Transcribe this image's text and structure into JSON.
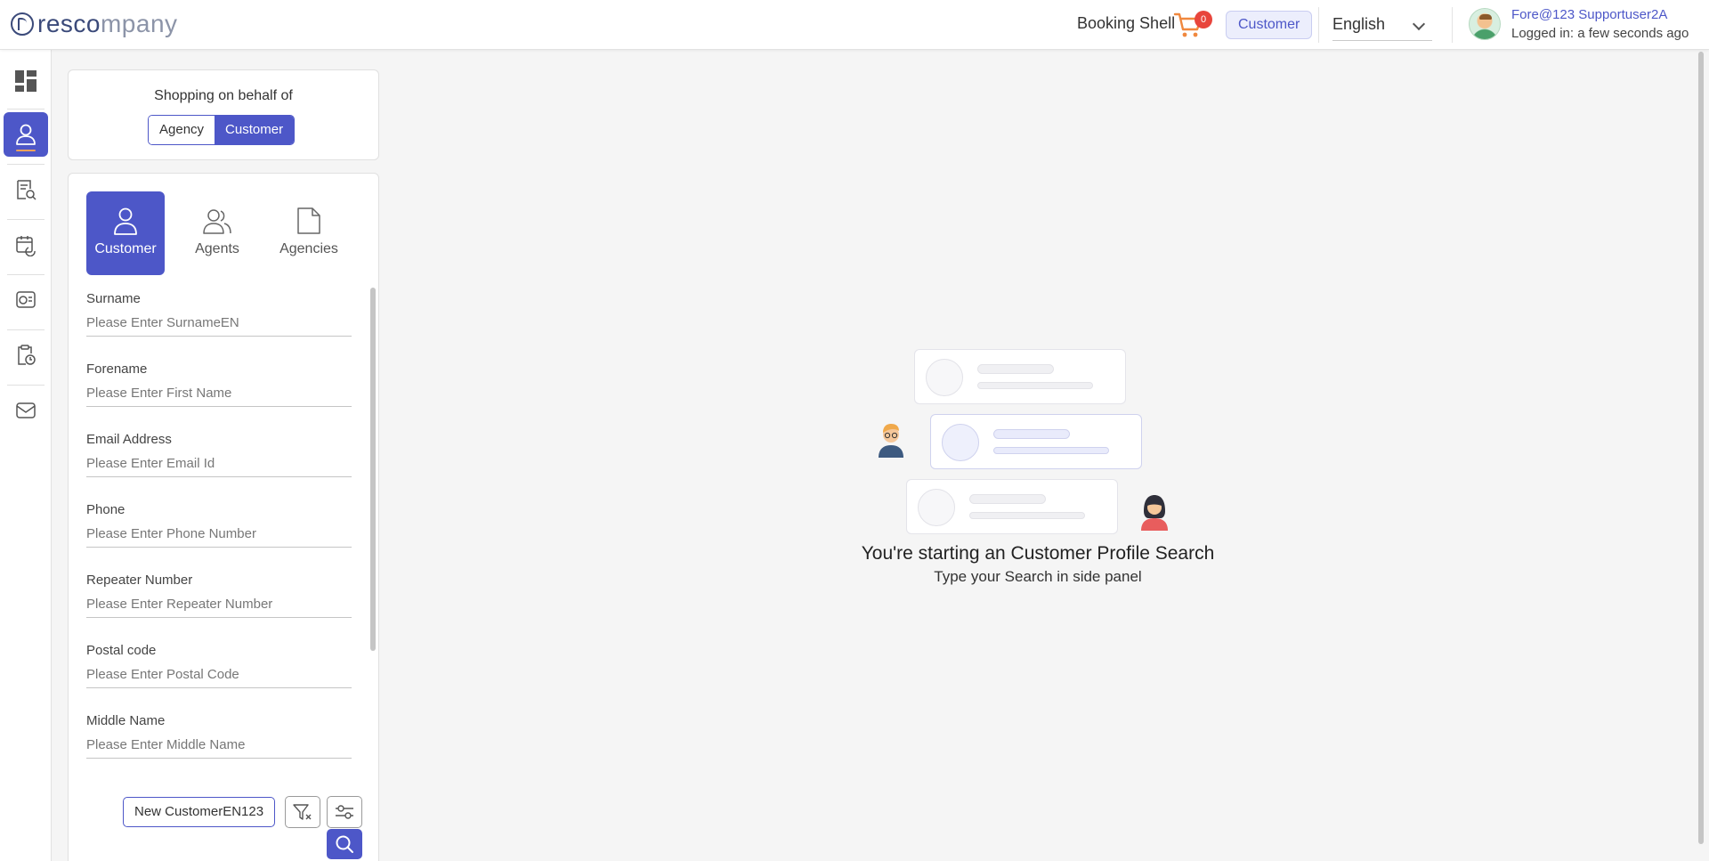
{
  "app": {
    "logo_text_dark": "resco",
    "logo_text_light": "mpany",
    "accent_color": "#4d57c8"
  },
  "header": {
    "booking_shell": "Booking Shell",
    "cart_count": "0",
    "role_badge": "Customer",
    "language": "English",
    "user_name": "Fore@123 Supportuser2A",
    "user_status": "Logged in: a few seconds ago"
  },
  "rail": {
    "items": [
      {
        "name": "dashboard-icon",
        "active": false
      },
      {
        "name": "profile-icon",
        "active": true
      },
      {
        "name": "booking-search-icon",
        "active": false
      },
      {
        "name": "calendar-refresh-icon",
        "active": false
      },
      {
        "name": "payments-icon",
        "active": false
      },
      {
        "name": "clipboard-clock-icon",
        "active": false
      },
      {
        "name": "mail-icon",
        "active": false
      }
    ]
  },
  "behalf": {
    "title": "Shopping on behalf of",
    "options": [
      "Agency",
      "Customer"
    ],
    "selected": "Customer"
  },
  "search": {
    "tabs": [
      {
        "label": "Customer",
        "icon": "user-icon",
        "active": true
      },
      {
        "label": "Agents",
        "icon": "users-icon",
        "active": false
      },
      {
        "label": "Agencies",
        "icon": "document-icon",
        "active": false
      }
    ],
    "fields": [
      {
        "label": "Surname",
        "placeholder": "Please Enter SurnameEN"
      },
      {
        "label": "Forename",
        "placeholder": "Please Enter First Name"
      },
      {
        "label": "Email Address",
        "placeholder": "Please Enter Email Id"
      },
      {
        "label": "Phone",
        "placeholder": "Please Enter Phone Number"
      },
      {
        "label": "Repeater Number",
        "placeholder": "Please Enter Repeater Number"
      },
      {
        "label": "Postal code",
        "placeholder": "Please Enter Postal Code"
      },
      {
        "label": "Middle Name",
        "placeholder": "Please Enter Middle Name"
      }
    ],
    "new_customer_label": "New CustomerEN123"
  },
  "empty_state": {
    "title": "You're starting an Customer Profile Search",
    "subtitle": "Type your Search in side panel"
  }
}
